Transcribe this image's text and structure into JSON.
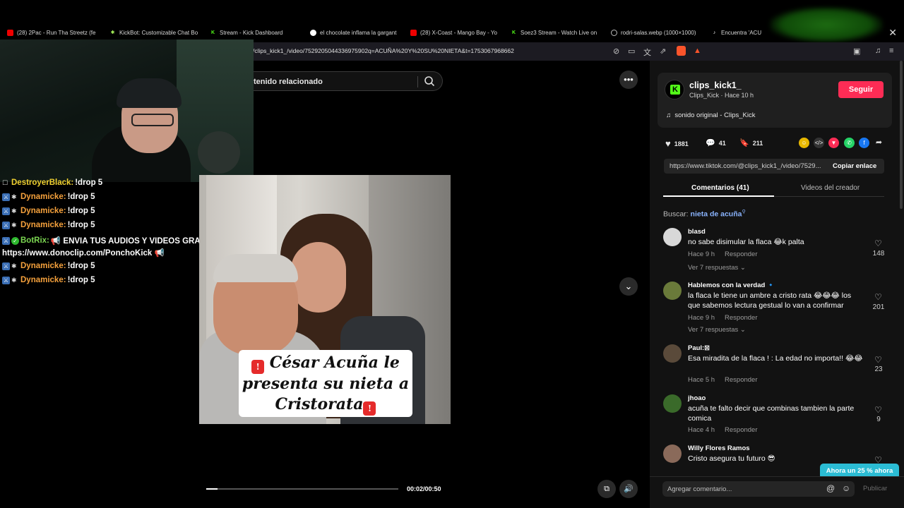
{
  "browser": {
    "tabs": [
      {
        "label": "(28) 2Pac - Run Tha Streetz (fe",
        "icon": "youtube-icon"
      },
      {
        "label": "KickBot: Customizable Chat Bo",
        "icon": "kickbot-icon"
      },
      {
        "label": "Stream - Kick Dashboard",
        "icon": "kick-icon"
      },
      {
        "label": "el chocolate inflama la gargant",
        "icon": "google-icon"
      },
      {
        "label": "(28) X-Coast - Mango Bay - Yo",
        "icon": "youtube-icon"
      },
      {
        "label": "Soez3 Stream - Watch Live on",
        "icon": "kick-icon"
      },
      {
        "label": "rodri-salas.webp (1000×1000)",
        "icon": "globe-icon"
      },
      {
        "label": "Encuentra 'ACU",
        "icon": "tiktok-icon"
      }
    ],
    "close_tab_glyph": "✕",
    "url": "/clips_kick1_/video/7529205044336975902q=ACUÑA%20Y%20SU%20NIETA&t=1753067968662"
  },
  "chat": {
    "messages": [
      {
        "user": "DestroyerBlack:",
        "text": " !drop 5",
        "color": "#f0d030"
      },
      {
        "user": "Dynamicke:",
        "text": " !drop 5",
        "color": "#f5a13c"
      },
      {
        "user": "Dynamicke:",
        "text": " !drop 5",
        "color": "#f5a13c"
      },
      {
        "user": "Dynamicke:",
        "text": " !drop 5",
        "color": "#f5a13c"
      },
      {
        "user": "BotRix:",
        "text": " 📢 ENVIA TUS AUDIOS Y VIDEOS GRATIS →",
        "color": "#7bd651"
      },
      {
        "user": "",
        "text": "https://www.donoclip.com/PonchoKick 📢",
        "color": "#fff"
      },
      {
        "user": "Dynamicke:",
        "text": " !drop 5",
        "color": "#f5a13c"
      },
      {
        "user": "Dynamicke:",
        "text": " !drop 5",
        "color": "#f5a13c"
      }
    ]
  },
  "search": {
    "text": "tenido relacionado"
  },
  "video": {
    "caption_line1": "César Acuña le",
    "caption_line2": "presenta su nieta a",
    "caption_line3": "Cristorata",
    "time": "00:02/00:50",
    "progress": 0.06
  },
  "author": {
    "name": "clips_kick1_",
    "meta": "Clips_Kick · Hace 10 h",
    "follow_label": "Seguir",
    "sound": "sonido original - Clips_Kick"
  },
  "stats": {
    "likes": "1881",
    "comments": "41",
    "saves": "211"
  },
  "link": {
    "url": "https://www.tiktok.com/@clips_kick1_/video/7529...",
    "copy_label": "Copiar enlace"
  },
  "tabs": {
    "comments": "Comentarios (41)",
    "creator": "Videos del creador"
  },
  "find": {
    "label": "Buscar:",
    "term": "nieta de acuña"
  },
  "comments": [
    {
      "user": "blasd",
      "text": "no sabe disimular la flaca 😂k palta",
      "time": "Hace 9 h",
      "reply": "Responder",
      "more": "Ver 7 respuestas ⌄",
      "likes": "148"
    },
    {
      "user": "Hablemos con la verdad 🔹",
      "text": "la flaca le tiene un ambre a cristo rata 😂😂😂 los que sabemos lectura gestual lo van a confirmar",
      "time": "Hace 9 h",
      "reply": "Responder",
      "more": "Ver 7 respuestas ⌄",
      "likes": "201"
    },
    {
      "user": "Paul:⊠",
      "text": "Esa miradita de la flaca ! : La edad no importa!! 😂😂",
      "time": "Hace 5 h",
      "reply": "Responder",
      "more": "",
      "likes": "23"
    },
    {
      "user": "jhoao",
      "text": "acuña te falto decir que combinas tambien la parte comica",
      "time": "Hace 4 h",
      "reply": "Responder",
      "more": "",
      "likes": "9"
    },
    {
      "user": "Willy Flores Ramos",
      "text": "Cristo asegura tu futuro 😎",
      "time": "",
      "reply": "",
      "more": "",
      "likes": ""
    }
  ],
  "add_comment": {
    "placeholder": "Agregar comentario...",
    "publish": "Publicar"
  },
  "promo": "Ahora un 25 % ahora"
}
